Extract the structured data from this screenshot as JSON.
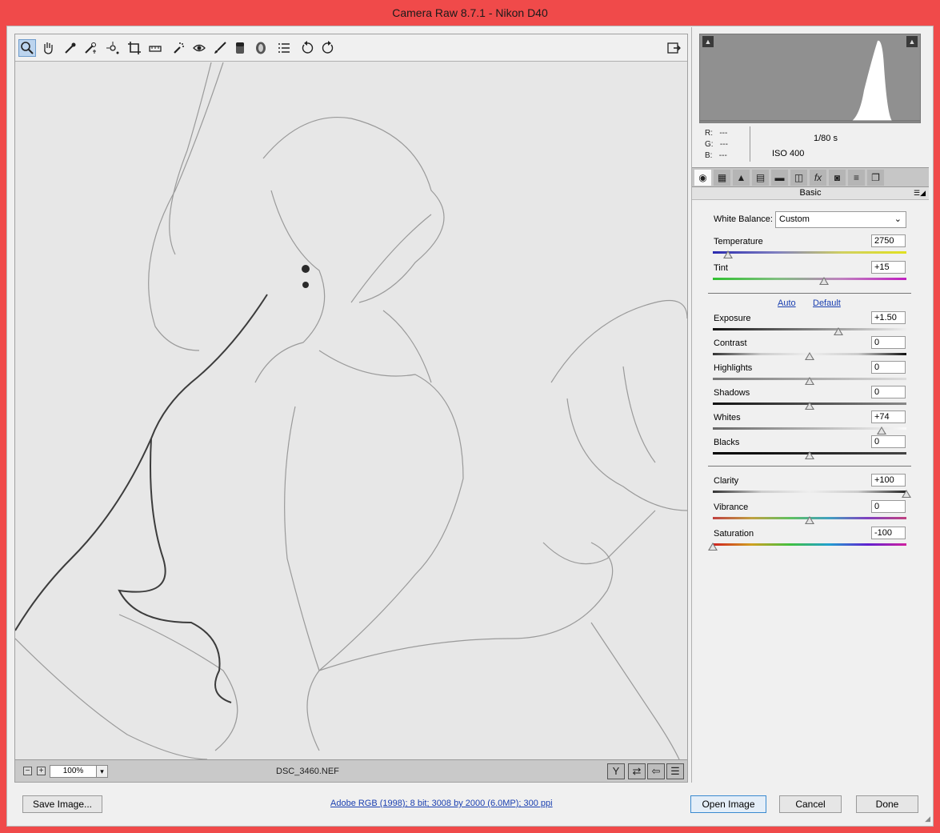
{
  "window": {
    "title": "Camera Raw 8.7.1  -  Nikon D40"
  },
  "toolbar": {
    "tools": [
      "zoom",
      "hand",
      "white-balance",
      "color-sampler",
      "targeted-adjustment",
      "crop",
      "straighten",
      "spot-removal",
      "red-eye",
      "adjustment-brush",
      "graduated-filter",
      "radial-filter",
      "preferences",
      "rotate-ccw",
      "rotate-cw"
    ],
    "toggle_fullscreen": "fullscreen-icon"
  },
  "status": {
    "zoom": "100%",
    "filename": "DSC_3460.NEF"
  },
  "info": {
    "r_label": "R:",
    "r_value": "---",
    "g_label": "G:",
    "g_value": "---",
    "b_label": "B:",
    "b_value": "---",
    "shutter": "1/80 s",
    "iso": "ISO 400"
  },
  "panel": {
    "section_title": "Basic",
    "white_balance_label": "White Balance:",
    "white_balance_value": "Custom",
    "auto_label": "Auto",
    "default_label": "Default",
    "sliders": {
      "temperature": {
        "label": "Temperature",
        "value": "2750",
        "pos": 0.08
      },
      "tint": {
        "label": "Tint",
        "value": "+15",
        "pos": 0.575
      },
      "exposure": {
        "label": "Exposure",
        "value": "+1.50",
        "pos": 0.65
      },
      "contrast": {
        "label": "Contrast",
        "value": "0",
        "pos": 0.5
      },
      "highlights": {
        "label": "Highlights",
        "value": "0",
        "pos": 0.5
      },
      "shadows": {
        "label": "Shadows",
        "value": "0",
        "pos": 0.5
      },
      "whites": {
        "label": "Whites",
        "value": "+74",
        "pos": 0.87
      },
      "blacks": {
        "label": "Blacks",
        "value": "0",
        "pos": 0.5
      },
      "clarity": {
        "label": "Clarity",
        "value": "+100",
        "pos": 1.0
      },
      "vibrance": {
        "label": "Vibrance",
        "value": "0",
        "pos": 0.5
      },
      "saturation": {
        "label": "Saturation",
        "value": "-100",
        "pos": 0.0
      }
    }
  },
  "footer": {
    "save_label": "Save Image...",
    "workflow_info": "Adobe RGB (1998); 8 bit; 3008 by 2000 (6.0MP); 300 ppi",
    "open_label": "Open Image",
    "cancel_label": "Cancel",
    "done_label": "Done"
  },
  "colors": {
    "title_bg": "#f04a4a",
    "link": "#1a3fb0",
    "accent": "#3a8ad0"
  }
}
